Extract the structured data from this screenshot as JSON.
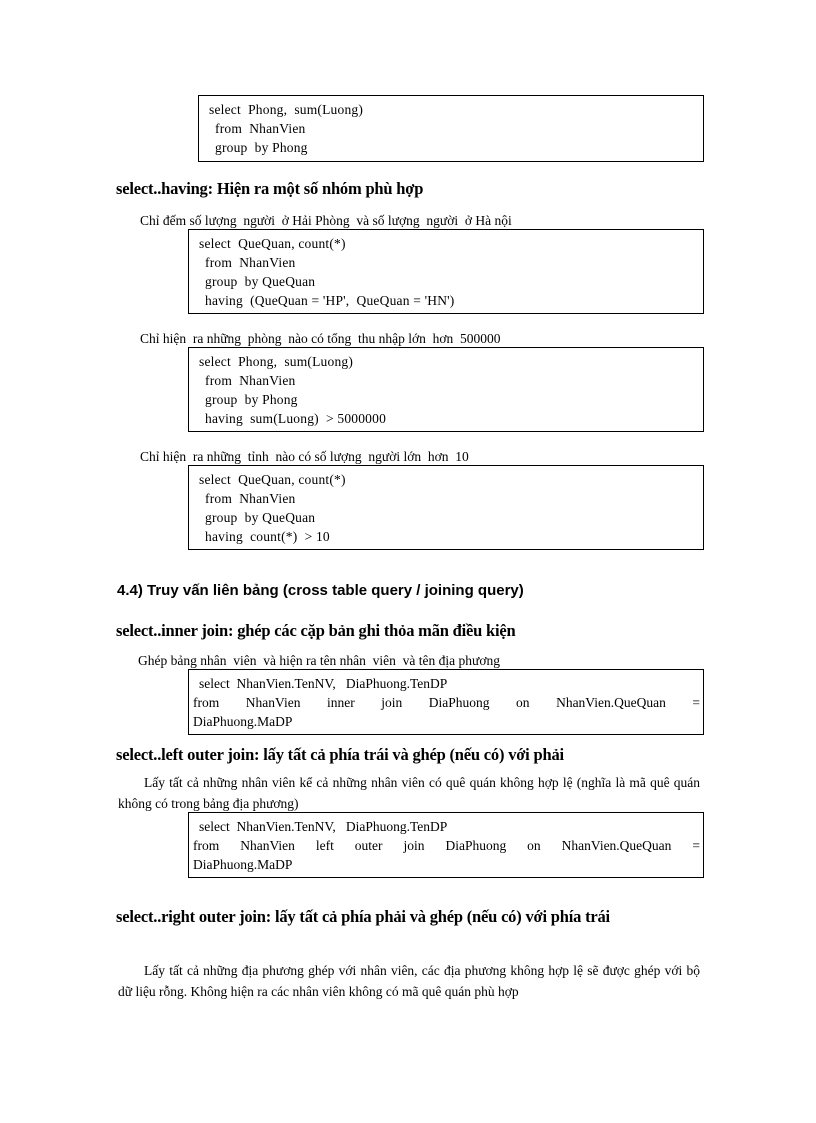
{
  "document": {
    "language": "vi",
    "background_color": "#ffffff",
    "text_color": "#000000"
  },
  "blocks": {
    "box_groupby": {
      "lines": [
        "select  Phong,  sum(Luong)",
        "from  NhanVien",
        "group  by Phong"
      ]
    },
    "heading_having": "select..having: Hiện ra một số nhóm phù hợp",
    "caption_having_1": "Chỉ đếm số lượng  người  ở Hải Phòng  và số lượng  người  ở Hà nội",
    "box_having_1": {
      "lines": [
        "select  QueQuan, count(*)",
        "from  NhanVien",
        "group  by QueQuan",
        "having  (QueQuan = 'HP',  QueQuan = 'HN')"
      ]
    },
    "caption_having_2": "Chỉ hiện  ra những  phòng  nào có tổng  thu nhập lớn  hơn  500000",
    "box_having_2": {
      "lines": [
        "select  Phong,  sum(Luong)",
        "from  NhanVien",
        "group  by Phong",
        "having  sum(Luong)  > 5000000"
      ]
    },
    "caption_having_3": "Chỉ hiện  ra những  tỉnh  nào có số lượng  người lớn  hơn  10",
    "box_having_3": {
      "lines": [
        "select  QueQuan, count(*)",
        "from  NhanVien",
        "group  by QueQuan",
        "having  count(*)  > 10"
      ]
    },
    "heading_section_44": "4.4) Truy vấn liên bảng (cross table  query / joining  query)",
    "heading_inner_join": "select..inner join: ghép các cặp bản ghi thỏa mãn điều kiện",
    "caption_inner_join": "Ghép bảng nhân  viên  và hiện ra tên nhân  viên  và tên địa phương",
    "box_inner_join": {
      "line1": "select  NhanVien.TenNV,   DiaPhuong.TenDP",
      "line2": "from     NhanVien     inner     join     DiaPhuong     on     NhanVien.QueQuan     =",
      "line3": "DiaPhuong.MaDP"
    },
    "heading_left_outer_join": "select..left outer join: lấy tất cả phía trái và ghép (nếu có) với phải",
    "para_left_outer_join": "Lấy tất cả những  nhân  viên  kể cả những  nhân  viên  có quê quán không  hợp lệ (nghĩa  là mã quê quán không  có trong  bảng  địa phương)",
    "box_left_outer_join": {
      "line1": "select  NhanVien.TenNV,   DiaPhuong.TenDP",
      "line2": "from    NhanVien    left    outer    join  DiaPhuong     on   NhanVien.QueQuan     =",
      "line3": "DiaPhuong.MaDP"
    },
    "heading_right_outer_join": "select..right outer join: lấy tất cả phía phải và ghép (nếu có) với phía trái",
    "para_right_outer_join": "Lấy tất cả những  địa phương  ghép với  nhân  viên,  các địa phương  không  hợp lệ sẽ được ghép với bộ dữ liệu rỗng. Không hiện ra các nhân  viên  không  có mã quê quán phù hợp"
  }
}
